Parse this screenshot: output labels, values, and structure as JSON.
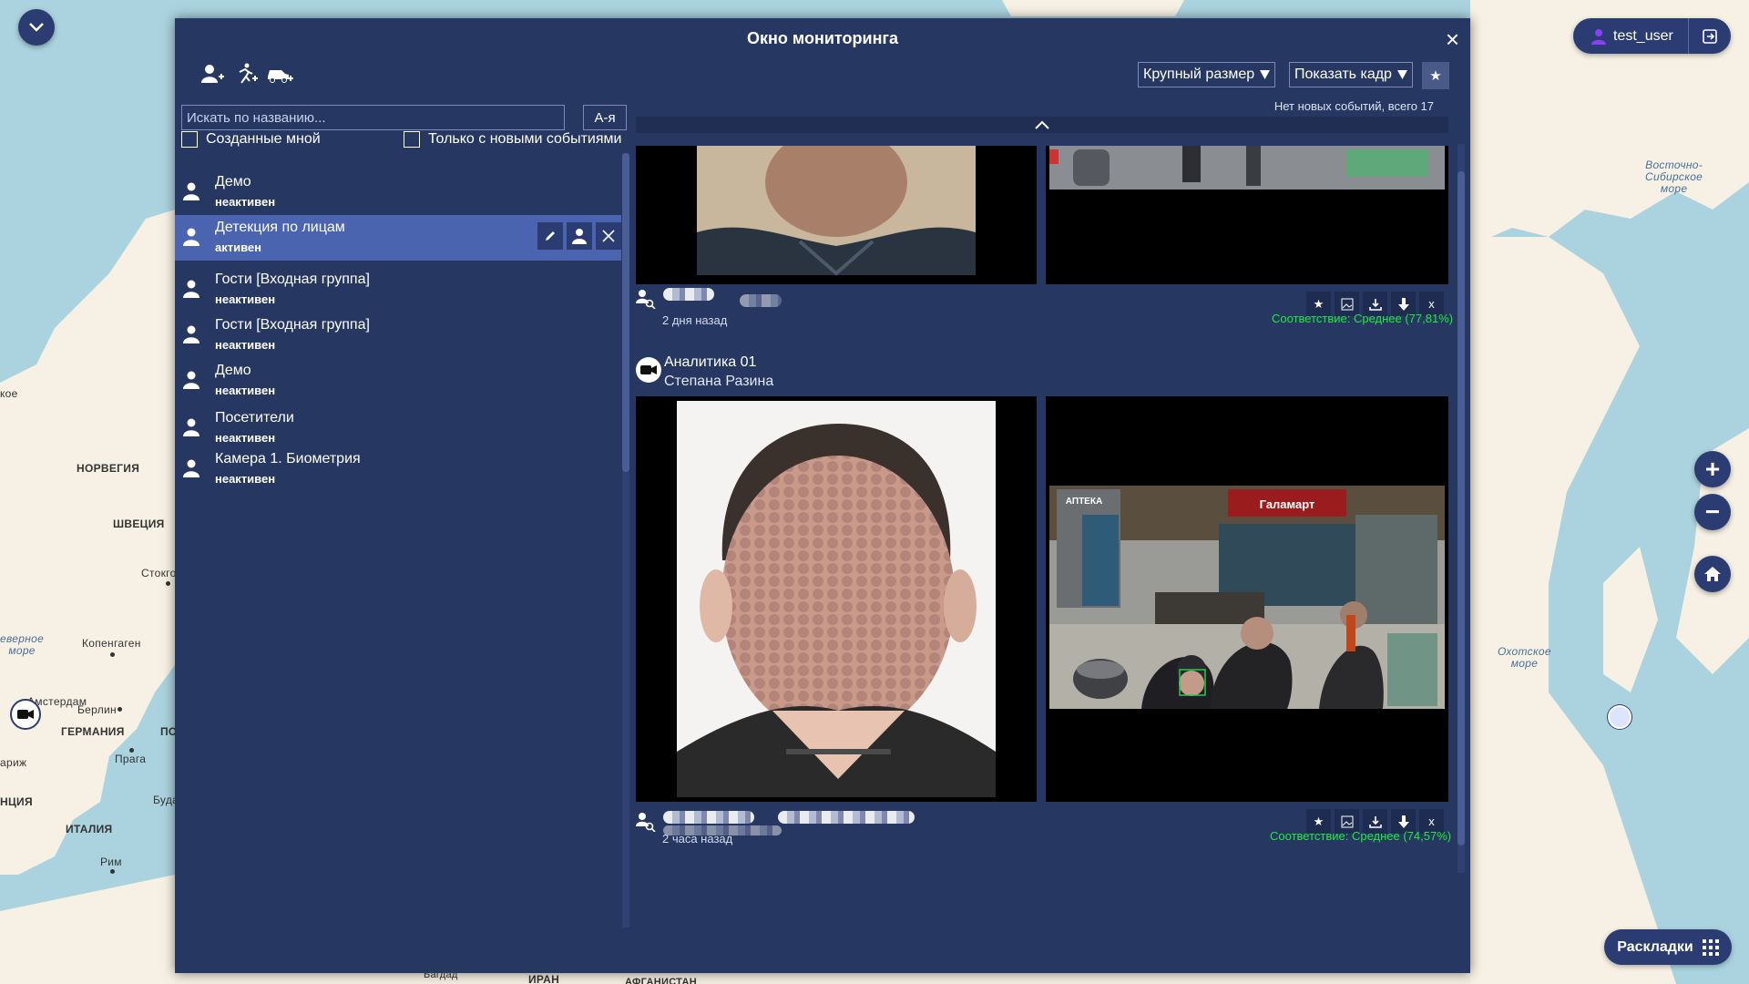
{
  "map": {
    "labels": {
      "norway": "НОРВЕГИЯ",
      "sweden": "ШВЕЦИЯ",
      "stockholm": "Стокго",
      "north_sea": "еверное\nморе",
      "copenhagen": "Копенгаген",
      "amsterdam": "Амстердам",
      "berlin": "Берлин",
      "germany": "ГЕРМАНИЯ",
      "poland": "ПО",
      "prague": "Прага",
      "paris": "ариж",
      "france": "НЦИЯ",
      "budapest": "Буда",
      "italy": "ИТАЛИЯ",
      "rome": "Рим",
      "baghdad": "Багдад",
      "iran": "ИРАН",
      "afghanistan": "АФГАНИСТАН",
      "east_siberian_sea": "Восточно-\nСибирское\nморе",
      "okhotsk_sea": "Охотское\nморе",
      "left_edge": "кое"
    }
  },
  "user": {
    "name": "test_user"
  },
  "layouts": {
    "label": "Раскладки"
  },
  "monitor": {
    "title": "Окно мониторинга",
    "search_placeholder": "Искать по названию...",
    "sort_label": "А-я",
    "filter_created_by_me": "Созданные мной",
    "filter_new_events_only": "Только с новыми событиями",
    "size_dropdown": "Крупный размер",
    "frame_dropdown": "Показать кадр",
    "events_info": "Нет новых событий, всего 17",
    "watchlists": [
      {
        "name": "Демо",
        "status": "неактивен",
        "active": false
      },
      {
        "name": "Детекция по лицам",
        "status": "активен",
        "active": true
      },
      {
        "name": "Гости [Входная группа]",
        "status": "неактивен",
        "active": false
      },
      {
        "name": "Гости [Входная группа]",
        "status": "неактивен",
        "active": false
      },
      {
        "name": "Демо",
        "status": "неактивен",
        "active": false
      },
      {
        "name": "Посетители",
        "status": "неактивен",
        "active": false
      },
      {
        "name": "Камера 1. Биометрия",
        "status": "неактивен",
        "active": false
      }
    ],
    "events": [
      {
        "time_ago": "2 дня назад",
        "match": "Соответствие: Среднее (77,81%)"
      },
      {
        "camera": "Аналитика  01",
        "location": "Степана Разина",
        "time_ago": "2 часа назад",
        "match": "Соответствие: Среднее (74,57%)",
        "store_signs": {
          "pharmacy": "АПТЕКА",
          "store": "Галамарт"
        }
      }
    ]
  },
  "colors": {
    "panel": "#263761",
    "accent": "#2b3c72",
    "active_row": "#4a64b0",
    "match_green": "#1eea3e",
    "land": "#f6f1e4",
    "water": "#aad3df"
  }
}
